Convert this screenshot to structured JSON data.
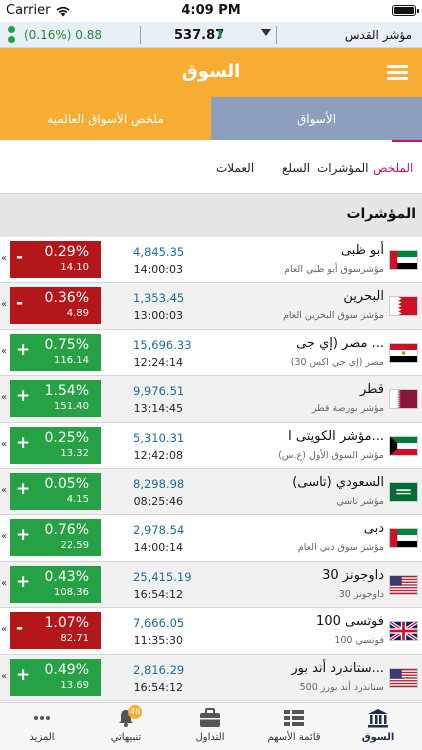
{
  "status_bar": {
    "carrier": "Carrier",
    "time": "4:09 PM"
  },
  "ticker": {
    "change": "(0.16%) 0.88",
    "value": "537.87",
    "index_name": "مؤشر القدس"
  },
  "header": {
    "title": "السوق"
  },
  "top_tabs": [
    {
      "label": "الأسواق",
      "active": false
    },
    {
      "label": "ملخص الأسواق العالمية",
      "active": true
    }
  ],
  "sub_tabs": [
    {
      "label": "الملخص",
      "active": true
    },
    {
      "label": "المؤشرات",
      "active": false
    },
    {
      "label": "السلع",
      "active": false
    },
    {
      "label": "العملات",
      "active": false
    }
  ],
  "section_title": "المؤشرات",
  "colors": {
    "accent": "#f7ac34",
    "up": "#26a146",
    "down": "#b3171b",
    "value_blue": "#1b6d95",
    "active_subtab": "#c0167a"
  },
  "rows": [
    {
      "name": "أبو ظبى",
      "sub": "مؤشرسوق أبو ظبي العام",
      "value": "4,845.35",
      "time": "14:00:03",
      "sign": "-",
      "pct": "0.29%",
      "abs": "14.10",
      "direction": "down",
      "flag": "uae-flag-icon"
    },
    {
      "name": "البحرين",
      "sub": "مؤشر سوق البحرين العام",
      "value": "1,353.45",
      "time": "13:00:03",
      "sign": "-",
      "pct": "0.36%",
      "abs": "4.89",
      "direction": "down",
      "flag": "bahrain-flag-icon"
    },
    {
      "name": "مصر (إي جى ...",
      "sub": "مصر (إي جي اكس 30)",
      "value": "15,696.33",
      "time": "12:24:14",
      "sign": "+",
      "pct": "0.75%",
      "abs": "116.14",
      "direction": "up",
      "flag": "egypt-flag-icon"
    },
    {
      "name": "قطر",
      "sub": "مؤشر بورصة قطر",
      "value": "9,976.51",
      "time": "13:14:45",
      "sign": "+",
      "pct": "1.54%",
      "abs": "151.40",
      "direction": "up",
      "flag": "qatar-flag-icon"
    },
    {
      "name": "مؤشر الكويتى ا...",
      "sub": "مؤشر السوق الأول (ع.س)",
      "value": "5,310.31",
      "time": "12:42:08",
      "sign": "+",
      "pct": "0.25%",
      "abs": "13.32",
      "direction": "up",
      "flag": "kuwait-flag-icon"
    },
    {
      "name": "السعودي (تاسى)",
      "sub": "مؤشر تاسي",
      "value": "8,298.98",
      "time": "08:25:46",
      "sign": "+",
      "pct": "0.05%",
      "abs": "4.15",
      "direction": "up",
      "flag": "saudi-flag-icon"
    },
    {
      "name": "دبى",
      "sub": "مؤشر سوق دبي العام",
      "value": "2,978.54",
      "time": "14:00:14",
      "sign": "+",
      "pct": "0.76%",
      "abs": "22.59",
      "direction": "up",
      "flag": "uae-flag-icon"
    },
    {
      "name": "داوجونز 30",
      "sub": "داوجونز 30",
      "value": "25,415.19",
      "time": "16:54:12",
      "sign": "+",
      "pct": "0.43%",
      "abs": "108.36",
      "direction": "up",
      "flag": "usa-flag-icon"
    },
    {
      "name": "فوتسى 100",
      "sub": "فوتسي 100",
      "value": "7,666.05",
      "time": "11:35:30",
      "sign": "-",
      "pct": "1.07%",
      "abs": "82.71",
      "direction": "down",
      "flag": "uk-flag-icon"
    },
    {
      "name": "ستاندرد أند بور...",
      "sub": "ستاندرد أند بورز 500",
      "value": "2,816.29",
      "time": "16:54:12",
      "sign": "+",
      "pct": "0.49%",
      "abs": "13.69",
      "direction": "up",
      "flag": "usa-flag-icon"
    }
  ],
  "bottom_nav": [
    {
      "label": "السوق",
      "icon": "bank-icon",
      "active": true
    },
    {
      "label": "قائمة الأسهم",
      "icon": "list-grid-icon",
      "active": false
    },
    {
      "label": "التداول",
      "icon": "briefcase-icon",
      "active": false
    },
    {
      "label": "تنبيهاتي",
      "icon": "bell-icon",
      "active": false,
      "badge": "46"
    },
    {
      "label": "المزيد",
      "icon": "more-dots-icon",
      "active": false
    }
  ]
}
